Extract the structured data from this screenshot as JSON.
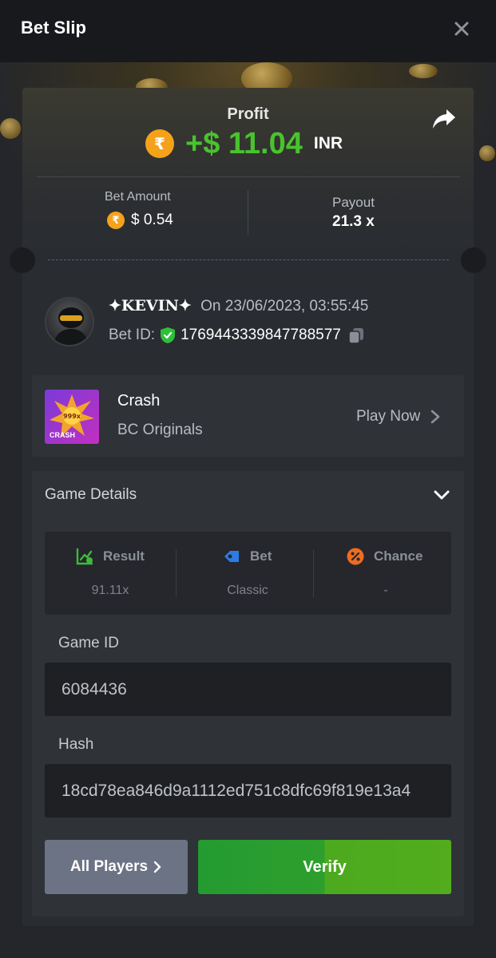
{
  "header": {
    "title": "Bet Slip"
  },
  "profit": {
    "label": "Profit",
    "currency_symbol": "₹",
    "amount": "+$ 11.04",
    "currency": "INR"
  },
  "bet": {
    "amount_label": "Bet Amount",
    "amount": "$ 0.54",
    "payout_label": "Payout",
    "payout": "21.3 x"
  },
  "player": {
    "name": "✦KEVIN✦",
    "date": "On 23/06/2023, 03:55:45",
    "bet_id_label": "Bet ID:",
    "bet_id": "1769443339847788577"
  },
  "game": {
    "name": "Crash",
    "provider": "BC Originals",
    "play_label": "Play Now",
    "thumb_text": "CRASH",
    "thumb_badge": "999x"
  },
  "details": {
    "title": "Game Details",
    "stats": [
      {
        "label": "Result",
        "value": "91.11x",
        "color": "#3fb93b"
      },
      {
        "label": "Bet",
        "value": "Classic",
        "color": "#2f7be6"
      },
      {
        "label": "Chance",
        "value": "-",
        "color": "#ef6b1f"
      }
    ],
    "game_id_label": "Game ID",
    "game_id": "6084436",
    "hash_label": "Hash",
    "hash": "18cd78ea846d9a1112ed751c8dfc69f819e13a4"
  },
  "buttons": {
    "all_players": "All Players",
    "verify": "Verify"
  },
  "colors": {
    "profit_green": "#49c32d",
    "coin_orange": "#f5a21b",
    "verify_green": "#2e9f2d",
    "button_gray": "#6b7384"
  }
}
